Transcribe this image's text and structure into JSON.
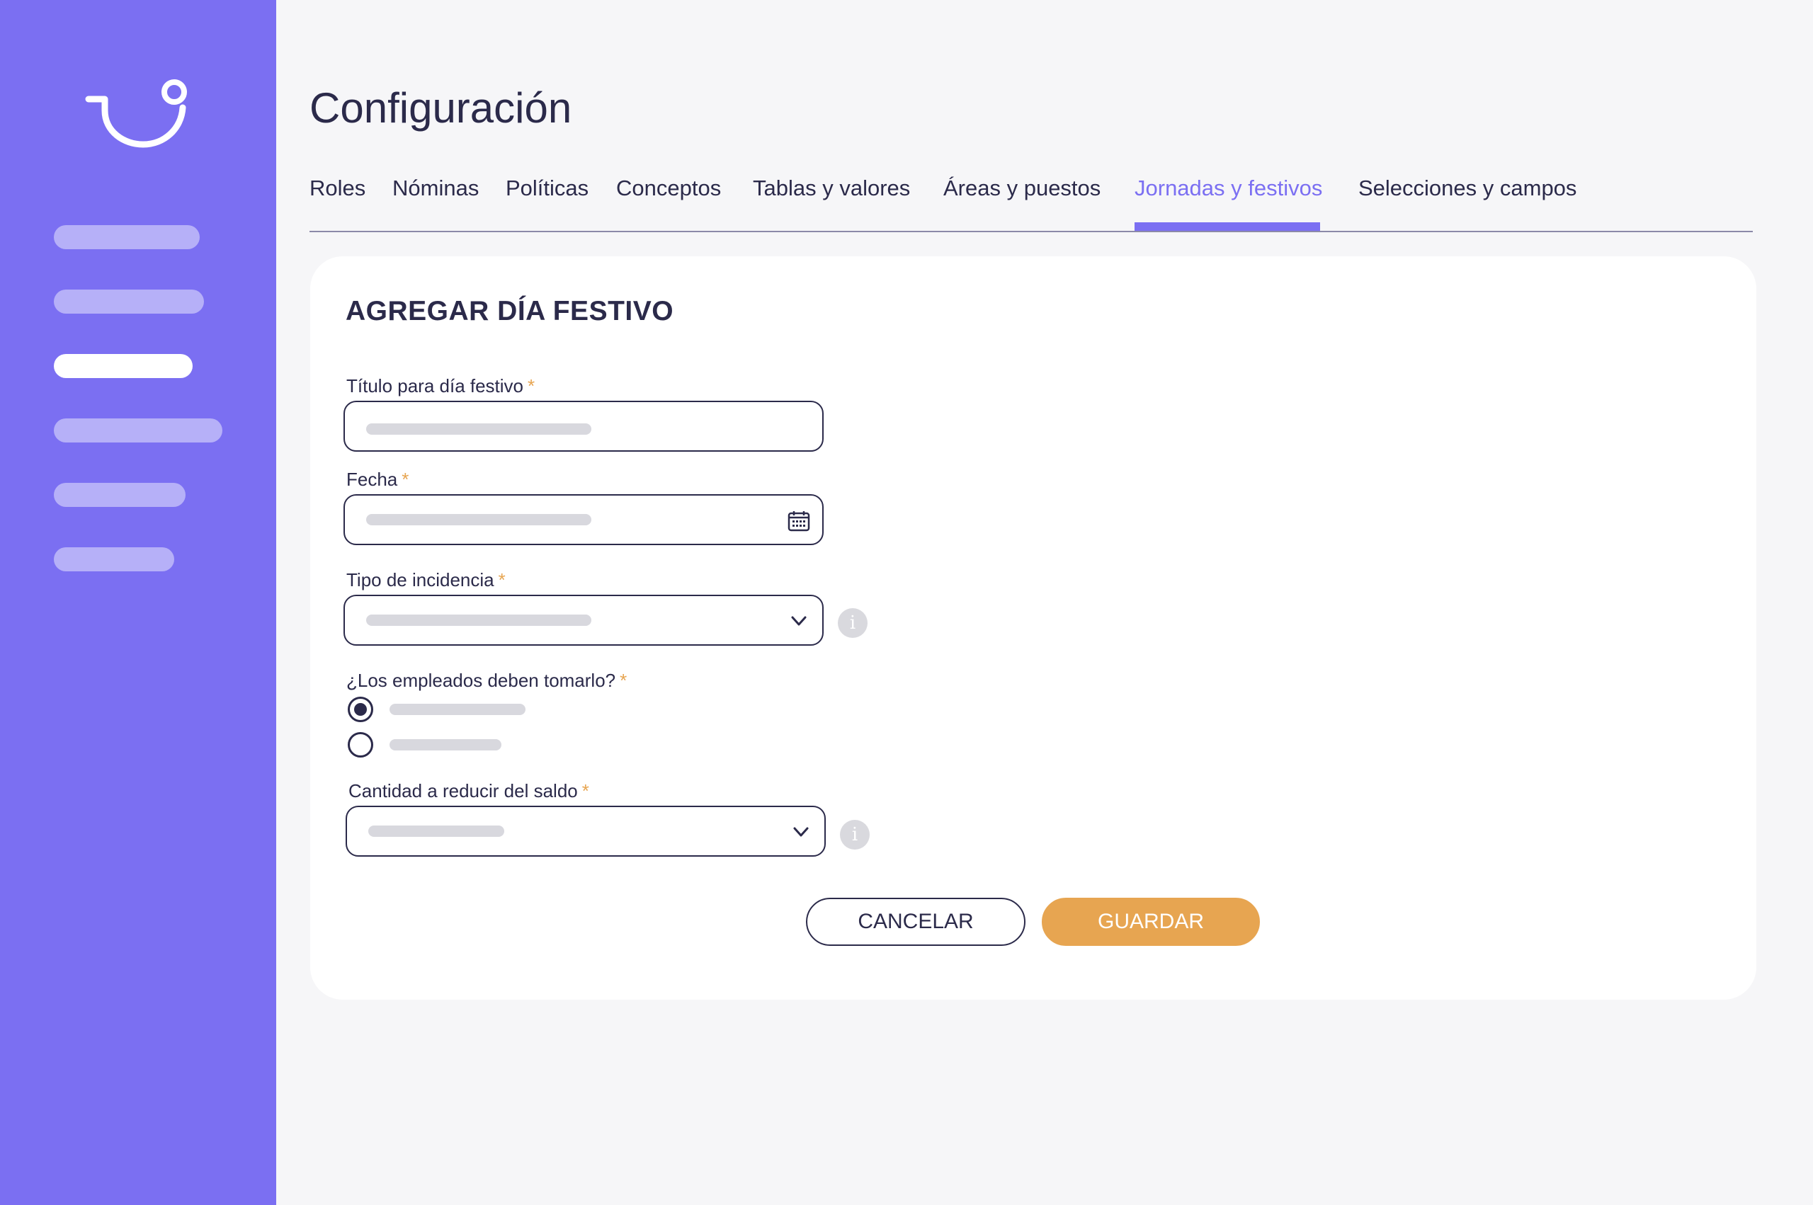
{
  "app": {
    "title": "Configuración"
  },
  "colors": {
    "accent": "#7b6ff2",
    "primary_button": "#e7a551",
    "text": "#2b2a4a",
    "required": "#e7a551",
    "placeholder": "#d8d8de"
  },
  "sidebar": {
    "logo_icon": "smile-hook-logo-icon",
    "nav_item_count": 6,
    "active_index": 2
  },
  "tabs": [
    {
      "label": "Roles"
    },
    {
      "label": "Nóminas"
    },
    {
      "label": "Políticas"
    },
    {
      "label": "Conceptos"
    },
    {
      "label": "Tablas y valores"
    },
    {
      "label": "Áreas y puestos"
    },
    {
      "label": "Jornadas y festivos",
      "active": true
    },
    {
      "label": "Selecciones y campos"
    }
  ],
  "form": {
    "title": "AGREGAR DÍA FESTIVO",
    "required_mark": "*",
    "holiday_title": {
      "label": "Título para día festivo",
      "value": ""
    },
    "date": {
      "label": "Fecha",
      "value": "",
      "icon": "calendar-icon"
    },
    "incidence_type": {
      "label": "Tipo de incidencia",
      "selected": "",
      "icon": "chevron-down-icon",
      "info_icon": "info-icon"
    },
    "must_take": {
      "label": "¿Los empleados deben tomarlo?",
      "selected_index": 0
    },
    "balance_reduction": {
      "label": "Cantidad a reducir del saldo",
      "selected": "",
      "icon": "chevron-down-icon",
      "info_icon": "info-icon"
    },
    "info_glyph": "i",
    "cancel_label": "CANCELAR",
    "save_label": "GUARDAR"
  }
}
